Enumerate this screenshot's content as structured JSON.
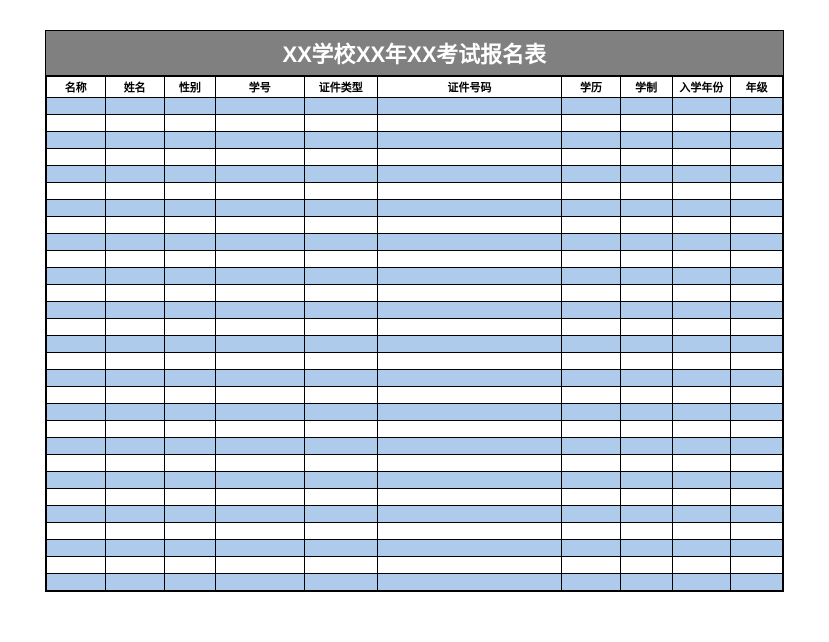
{
  "title": "XX学校XX年XX考试报名表",
  "headers": {
    "name": "名称",
    "xingming": "姓名",
    "xingbie": "性别",
    "xuehao": "学号",
    "zhengjianleixing": "证件类型",
    "zhengjianhao": "证件号码",
    "xueli": "学历",
    "xuezhi": "学制",
    "ruxuenianfen": "入学年份",
    "nianji": "年级"
  },
  "row_count": 29
}
